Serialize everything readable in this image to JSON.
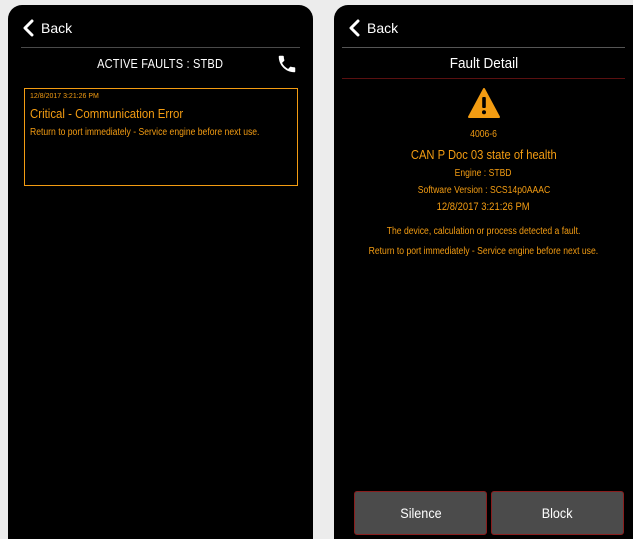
{
  "left": {
    "back_label": "Back",
    "title": "ACTIVE FAULTS : STBD",
    "faults": [
      {
        "timestamp": "12/8/2017 3:21:26 PM",
        "title": "Critical - Communication Error",
        "message": "Return to port immediately - Service engine before next use."
      }
    ]
  },
  "right": {
    "back_label": "Back",
    "title": "Fault Detail",
    "code": "4006-6",
    "fault_name": "CAN P Doc 03 state of health",
    "engine": "Engine : STBD",
    "software_version": "Software Version : SCS14p0AAAC",
    "date": "12/8/2017 3:21:26 PM",
    "description": "The device, calculation or process detected a fault.",
    "action": "Return to port immediately - Service engine before next use.",
    "silence_label": "Silence",
    "block_label": "Block"
  },
  "colors": {
    "accent": "#f39c12",
    "background": "#000000",
    "button_bg": "#4b4b4b",
    "button_border": "#8a1e1e"
  },
  "icons": [
    "chevron-left-icon",
    "phone-icon",
    "warning-icon"
  ]
}
